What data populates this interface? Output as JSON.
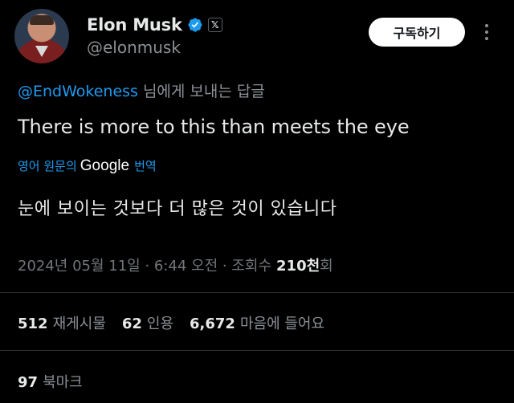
{
  "author": {
    "name": "Elon Musk",
    "handle": "@elonmusk",
    "x_badge": "𝕏"
  },
  "subscribe_label": "구독하기",
  "reply": {
    "mention": "@EndWokeness",
    "suffix": "님에게 보내는 답글"
  },
  "tweet_text": "There is more to this than meets the eye",
  "translation": {
    "prefix": "영어 원문의",
    "brand": "Google",
    "suffix": "번역",
    "text": "눈에 보이는 것보다 더 많은 것이 있습니다"
  },
  "meta": {
    "timestamp": "2024년 05월 11일 · 6:44 오전 · 조회수",
    "views": "210천",
    "views_suffix": "회"
  },
  "stats": [
    {
      "count": "512",
      "label": "재게시물"
    },
    {
      "count": "62",
      "label": "인용"
    },
    {
      "count": "6,672",
      "label": "마음에 들어요"
    }
  ],
  "bookmarks": {
    "count": "97",
    "label": "북마크"
  },
  "colors": {
    "background": "#000000",
    "accent": "#1d9bf0",
    "text_primary": "#e7e9ea",
    "text_secondary": "#71767b"
  }
}
